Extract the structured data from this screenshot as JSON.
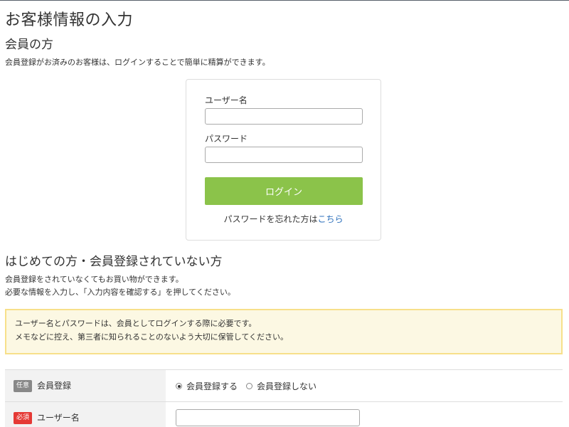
{
  "page": {
    "title": "お客様情報の入力"
  },
  "member_section": {
    "title": "会員の方",
    "description": "会員登録がお済みのお客様は、ログインすることで簡単に精算ができます。",
    "login_box": {
      "username_label": "ユーザー名",
      "username_value": "",
      "password_label": "パスワード",
      "password_value": "",
      "login_button_label": "ログイン",
      "forgot_text": "パスワードを忘れた方は",
      "forgot_link_label": "こちら",
      "button_color": "#8bc34a",
      "link_color": "#2a6ebb"
    }
  },
  "guest_section": {
    "title": "はじめての方・会員登録されていない方",
    "description_lines": [
      "会員登録をされていなくてもお買い物ができます。",
      "必要な情報を入力し、「入力内容を確認する」を押してください。"
    ],
    "notice": {
      "lines": [
        "ユーザー名とパスワードは、会員としてログインする際に必要です。",
        "メモなどに控え、第三者に知られることのないよう大切に保管してください。"
      ],
      "background_color": "#fcf8e3",
      "border_color": "#f7e08a"
    }
  },
  "form": {
    "rows": [
      {
        "badge": "任意",
        "label": "会員登録",
        "type": "radio",
        "options": [
          {
            "label": "会員登録する",
            "checked": true
          },
          {
            "label": "会員登録しない",
            "checked": false
          }
        ]
      },
      {
        "badge": "必須",
        "label": "ユーザー名",
        "type": "text",
        "value": ""
      }
    ],
    "badge_optional_color": "#888888",
    "badge_required_color": "#e53935"
  }
}
